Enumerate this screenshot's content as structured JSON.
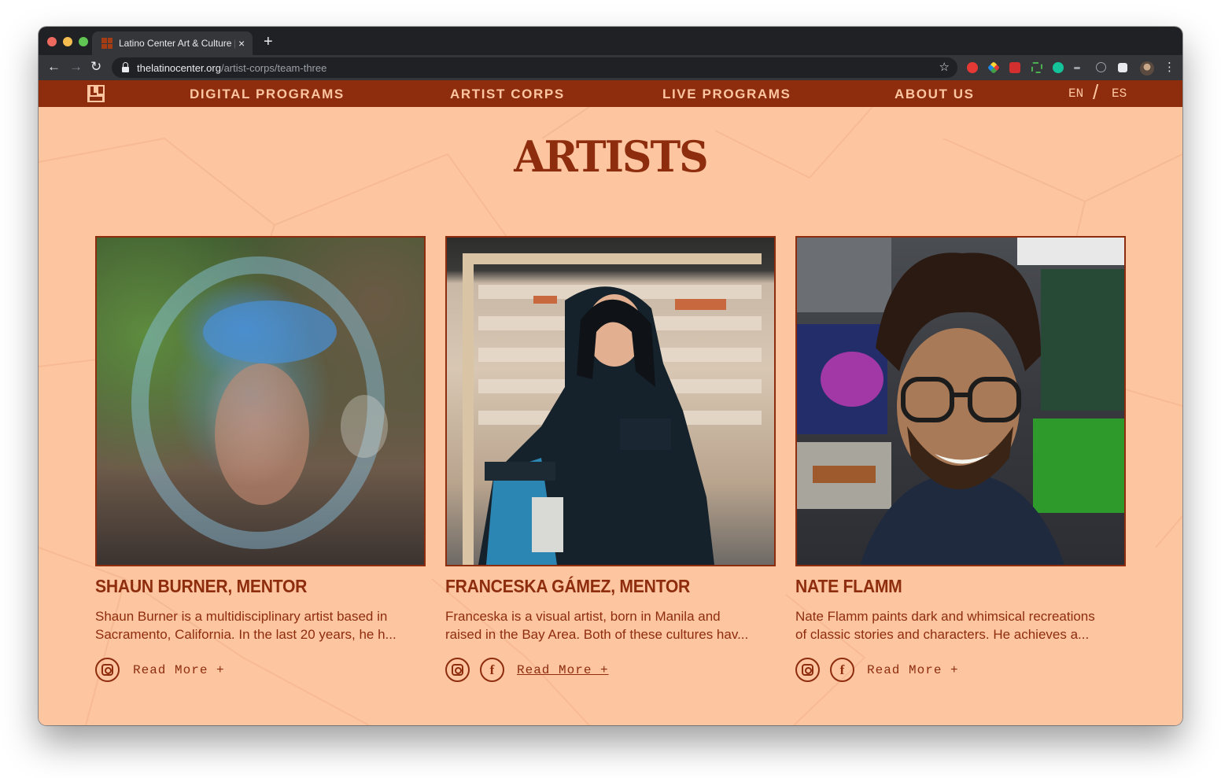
{
  "browser": {
    "tab_title": "Latino Center Art & Culture | V",
    "tab_close": "×",
    "new_tab": "+",
    "url_host": "thelatinocenter.org",
    "url_path": "/artist-corps/team-three",
    "back": "←",
    "forward": "→",
    "reload": "↻",
    "bookmark": "☆",
    "menu": "⋮"
  },
  "nav": {
    "links": [
      "DIGITAL PROGRAMS",
      "ARTIST CORPS",
      "LIVE PROGRAMS",
      "ABOUT US"
    ],
    "lang_en": "EN",
    "lang_sep": "/",
    "lang_es": "ES"
  },
  "page": {
    "title": "ARTISTS"
  },
  "artists": [
    {
      "name": "SHAUN BURNER, MENTOR",
      "bio_line1": "Shaun Burner is a multidisciplinary artist based in",
      "bio_line2": "Sacramento, California. In the last 20 years, he h...",
      "read_more": "Read More +",
      "social": [
        "instagram-icon"
      ]
    },
    {
      "name": "FRANCESKA GÁMEZ, MENTOR",
      "bio_line1": "Franceska is a visual artist, born in Manila and",
      "bio_line2": "raised in the Bay Area. Both of these cultures hav...",
      "read_more": "Read More +",
      "social": [
        "instagram-icon",
        "facebook-icon"
      ]
    },
    {
      "name": "NATE FLAMM",
      "bio_line1": "Nate Flamm paints dark and whimsical recreations",
      "bio_line2": "of classic stories and characters. He achieves a...",
      "read_more": "Read More +",
      "social": [
        "instagram-icon",
        "facebook-icon"
      ]
    }
  ],
  "icons": {
    "facebook_glyph": "f"
  },
  "colors": {
    "brand": "#8e2c0e",
    "background": "#fdc6a0",
    "chrome_dark": "#202124",
    "chrome_toolbar": "#35363a"
  }
}
